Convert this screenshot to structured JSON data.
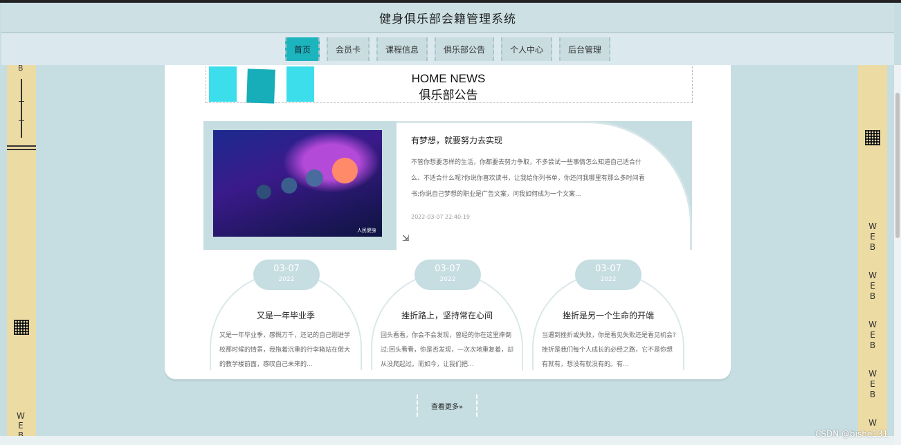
{
  "header": {
    "title": "健身俱乐部会籍管理系统"
  },
  "nav": [
    {
      "label": "首页",
      "active": true
    },
    {
      "label": "会员卡"
    },
    {
      "label": "课程信息"
    },
    {
      "label": "俱乐部公告"
    },
    {
      "label": "个人中心"
    },
    {
      "label": "后台管理"
    }
  ],
  "section": {
    "title_en": "HOME NEWS",
    "title_cn": "俱乐部公告"
  },
  "featured": {
    "title": "有梦想，就要努力去实现",
    "body": "不管你想要怎样的生活，你都要去努力争取，不多尝试一些事情怎么知道自己适合什么、不适合什么呢?你说你喜欢读书，让我给你列书单，你还问我哪里有那么多时间看书;你说自己梦想的职业是广告文案，问我如何成为一个文案...",
    "date": "2022-03-07 22:40:19",
    "image_badge": "人民健身"
  },
  "news": [
    {
      "md": "03-07",
      "year": "2022",
      "title": "又是一年毕业季",
      "body": "又是一年毕业季，感慨万千，还记的自己刚进学校那时候的情景，我拖着沉重的行李箱站在偌大的教学楼前面，感叹自己未来的..."
    },
    {
      "md": "03-07",
      "year": "2022",
      "title": "挫折路上，坚持常在心间",
      "body": "回头看看，你会不会发现，曾经的你在这里摔倒过;回头看看，你是否发现，一次次地重复着，却从没爬起过。而如今，让我们把..."
    },
    {
      "md": "03-07",
      "year": "2022",
      "title": "挫折是另一个生命的开端",
      "body": "当遇到挫折或失败，你是看见失败还是看见机会?挫折是我们每个人成长的必经之路，它不是你想有就有，想没有就没有的。有..."
    }
  ],
  "more": {
    "label": "查看更多»"
  },
  "side": {
    "left_top": "B",
    "left_bottom": [
      "W",
      "E",
      "B"
    ],
    "right_letters": [
      "W",
      "E",
      "B",
      "W",
      "E",
      "B",
      "W",
      "E",
      "B",
      "W",
      "E",
      "B",
      "W"
    ]
  },
  "watermark": "CSDN @bishe131"
}
